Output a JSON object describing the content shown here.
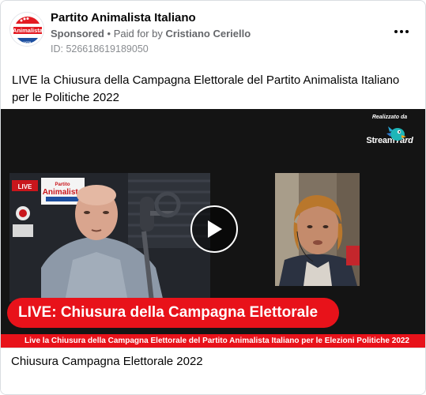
{
  "header": {
    "page_name": "Partito Animalista Italiano",
    "sponsored": "Sponsored",
    "separator": "•",
    "paid_for_prefix": "Paid for by",
    "paid_for_name": "Cristiano Ceriello",
    "ad_id": "ID: 526618619189050",
    "avatar_lines": [
      "Partito",
      "Animalista",
      "UCDL"
    ]
  },
  "post": {
    "text": "LIVE la Chiusura della Campagna Elettorale del Partito Animalista Italiano per le Politiche 2022"
  },
  "video": {
    "credit_small": "Realizzato da",
    "credit_brand_a": "Stream",
    "credit_brand_b": "Yard",
    "studio_sign": "Animalista",
    "studio_sign_top": "Partito",
    "live_badge": "LIVE",
    "banner_text": "LIVE: Chiusura della Campagna Elettorale",
    "ticker_text": "Live la Chiusura della Campagna Elettorale del Partito Animalista Italiano per le Elezioni Politiche 2022"
  },
  "caption": {
    "title": "Chiusura Campagna Elettorale 2022"
  },
  "colors": {
    "live_red": "#e8121a",
    "text_primary": "#050505",
    "text_secondary": "#65676b"
  },
  "icons": {
    "more": "more-horizontal-icon",
    "play": "play-icon",
    "streamyard": "streamyard-logo-icon"
  }
}
